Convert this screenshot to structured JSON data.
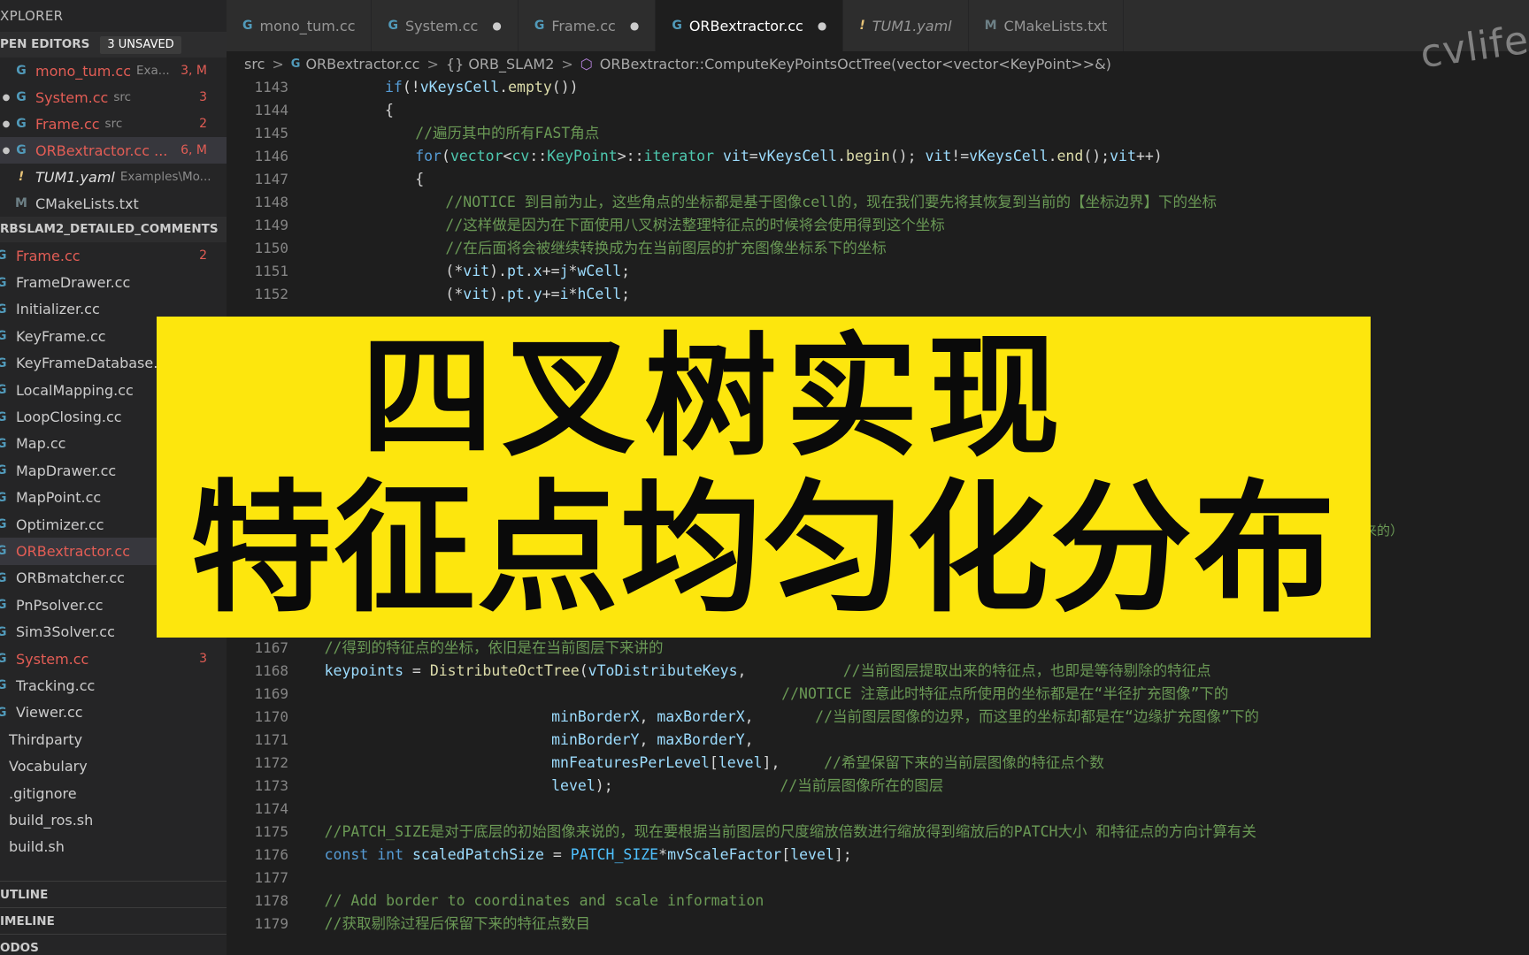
{
  "sidebar": {
    "title": "XPLORER",
    "open_editors": {
      "label": "PEN EDITORS",
      "badge": "3 UNSAVED",
      "items": [
        {
          "name": "mono_tum.cc",
          "desc": "Exa...",
          "status": "3, M",
          "dirty": false
        },
        {
          "name": "System.cc",
          "desc": "src",
          "status": "3",
          "dirty": true
        },
        {
          "name": "Frame.cc",
          "desc": "src",
          "status": "2",
          "dirty": true
        },
        {
          "name": "ORBextractor.cc ...",
          "desc": "",
          "status": "6, M",
          "dirty": true
        },
        {
          "name": "TUM1.yaml",
          "desc": "Examples\\Mo...",
          "status": "",
          "dirty": false
        },
        {
          "name": "CMakeLists.txt",
          "desc": "",
          "status": "",
          "dirty": false
        }
      ]
    },
    "project": {
      "label": "RBSLAM2_DETAILED_COMMENTS",
      "files": [
        {
          "name": "Frame.cc",
          "status": "2"
        },
        {
          "name": "FrameDrawer.cc",
          "status": ""
        },
        {
          "name": "Initializer.cc",
          "status": ""
        },
        {
          "name": "KeyFrame.cc",
          "status": ""
        },
        {
          "name": "KeyFrameDatabase.",
          "status": ""
        },
        {
          "name": "LocalMapping.cc",
          "status": ""
        },
        {
          "name": "LoopClosing.cc",
          "status": ""
        },
        {
          "name": "Map.cc",
          "status": ""
        },
        {
          "name": "MapDrawer.cc",
          "status": ""
        },
        {
          "name": "MapPoint.cc",
          "status": ""
        },
        {
          "name": "Optimizer.cc",
          "status": ""
        },
        {
          "name": "ORBextractor.cc",
          "status": ""
        },
        {
          "name": "ORBmatcher.cc",
          "status": ""
        },
        {
          "name": "PnPsolver.cc",
          "status": ""
        },
        {
          "name": "Sim3Solver.cc",
          "status": ""
        },
        {
          "name": "System.cc",
          "status": "3"
        },
        {
          "name": "Tracking.cc",
          "status": ""
        },
        {
          "name": "Viewer.cc",
          "status": ""
        },
        {
          "name": "Thirdparty",
          "status": ""
        },
        {
          "name": "Vocabulary",
          "status": ""
        },
        {
          "name": ".gitignore",
          "status": ""
        },
        {
          "name": "build_ros.sh",
          "status": ""
        },
        {
          "name": "build.sh",
          "status": ""
        }
      ]
    },
    "outline": "UTLINE",
    "timeline": "IMELINE",
    "todos": "ODOS"
  },
  "tabs": [
    {
      "label": "mono_tum.cc",
      "dirty": false,
      "active": false
    },
    {
      "label": "System.cc",
      "dirty": true,
      "active": false
    },
    {
      "label": "Frame.cc",
      "dirty": true,
      "active": false
    },
    {
      "label": "ORBextractor.cc",
      "dirty": true,
      "active": true
    },
    {
      "label": "TUM1.yaml",
      "dirty": false,
      "active": false
    },
    {
      "label": "CMakeLists.txt",
      "dirty": false,
      "active": false
    }
  ],
  "breadcrumb": {
    "src": "src",
    "file": "ORBextractor.cc",
    "namespace": "{} ORB_SLAM2",
    "symbol": "ORBextractor::ComputeKeyPointsOctTree(vector<vector<KeyPoint>>&)"
  },
  "watermark": "cvlife",
  "banner": {
    "line1": "四叉树实现",
    "line2": "特征点均匀化分布"
  },
  "editor": {
    "partial_right_text": "来的）",
    "lines": [
      {
        "n": "1143",
        "indent": 20,
        "segs": [
          [
            "kw",
            "if"
          ],
          [
            "pl",
            "(!"
          ],
          [
            "vr",
            "vKeysCell"
          ],
          [
            "pl",
            "."
          ],
          [
            "fn",
            "empty"
          ],
          [
            "pl",
            "())"
          ]
        ]
      },
      {
        "n": "1144",
        "indent": 20,
        "segs": [
          [
            "pl",
            "{"
          ]
        ]
      },
      {
        "n": "1145",
        "indent": 24,
        "segs": [
          [
            "cmt",
            "//遍历其中的所有FAST角点"
          ]
        ]
      },
      {
        "n": "1146",
        "indent": 24,
        "segs": [
          [
            "kw",
            "for"
          ],
          [
            "pl",
            "("
          ],
          [
            "ty",
            "vector"
          ],
          [
            "pl",
            "<"
          ],
          [
            "ty",
            "cv"
          ],
          [
            "pl",
            "::"
          ],
          [
            "ty",
            "KeyPoint"
          ],
          [
            "pl",
            ">::"
          ],
          [
            "ty",
            "iterator"
          ],
          [
            "pl",
            " "
          ],
          [
            "vr",
            "vit"
          ],
          [
            "pl",
            "="
          ],
          [
            "vr",
            "vKeysCell"
          ],
          [
            "pl",
            "."
          ],
          [
            "fn",
            "begin"
          ],
          [
            "pl",
            "(); "
          ],
          [
            "vr",
            "vit"
          ],
          [
            "pl",
            "!="
          ],
          [
            "vr",
            "vKeysCell"
          ],
          [
            "pl",
            "."
          ],
          [
            "fn",
            "end"
          ],
          [
            "pl",
            "();"
          ],
          [
            "vr",
            "vit"
          ],
          [
            "pl",
            "++)"
          ]
        ]
      },
      {
        "n": "1147",
        "indent": 24,
        "segs": [
          [
            "pl",
            "{"
          ]
        ]
      },
      {
        "n": "1148",
        "indent": 28,
        "segs": [
          [
            "cmt",
            "//NOTICE 到目前为止，这些角点的坐标都是基于图像cell的，现在我们要先将其恢复到当前的【坐标边界】下的坐标"
          ]
        ]
      },
      {
        "n": "1149",
        "indent": 28,
        "segs": [
          [
            "cmt",
            "//这样做是因为在下面使用八叉树法整理特征点的时候将会使用得到这个坐标"
          ]
        ]
      },
      {
        "n": "1150",
        "indent": 28,
        "segs": [
          [
            "cmt",
            "//在后面将会被继续转换成为在当前图层的扩充图像坐标系下的坐标"
          ]
        ]
      },
      {
        "n": "1151",
        "indent": 28,
        "segs": [
          [
            "pl",
            "(*"
          ],
          [
            "vr",
            "vit"
          ],
          [
            "pl",
            ")."
          ],
          [
            "vr",
            "pt"
          ],
          [
            "pl",
            "."
          ],
          [
            "vr",
            "x"
          ],
          [
            "pl",
            "+="
          ],
          [
            "vr",
            "j"
          ],
          [
            "pl",
            "*"
          ],
          [
            "vr",
            "wCell"
          ],
          [
            "pl",
            ";"
          ]
        ]
      },
      {
        "n": "1152",
        "indent": 28,
        "segs": [
          [
            "pl",
            "(*"
          ],
          [
            "vr",
            "vit"
          ],
          [
            "pl",
            ")."
          ],
          [
            "vr",
            "pt"
          ],
          [
            "pl",
            "."
          ],
          [
            "vr",
            "y"
          ],
          [
            "pl",
            "+="
          ],
          [
            "vr",
            "i"
          ],
          [
            "pl",
            "*"
          ],
          [
            "vr",
            "hCell"
          ],
          [
            "pl",
            ";"
          ]
        ]
      },
      {
        "n": "1167",
        "indent": 12,
        "segs": [
          [
            "cmt",
            "//得到的特征点的坐标，依旧是在当前图层下来讲的"
          ]
        ]
      },
      {
        "n": "1168",
        "indent": 12,
        "segs": [
          [
            "vr",
            "keypoints"
          ],
          [
            "pl",
            " = "
          ],
          [
            "fn",
            "DistributeOctTree"
          ],
          [
            "pl",
            "("
          ],
          [
            "vr",
            "vToDistributeKeys"
          ],
          [
            "pl",
            ",           "
          ],
          [
            "cmt",
            "//当前图层提取出来的特征点，也即是等待剔除的特征点"
          ]
        ]
      },
      {
        "n": "1169",
        "indent": 12,
        "segs": [
          [
            "pl",
            "                                                    "
          ],
          [
            "cmt",
            "//NOTICE 注意此时特征点所使用的坐标都是在“半径扩充图像”下的"
          ]
        ]
      },
      {
        "n": "1170",
        "indent": 42,
        "segs": [
          [
            "vr",
            "minBorderX"
          ],
          [
            "pl",
            ", "
          ],
          [
            "vr",
            "maxBorderX"
          ],
          [
            "pl",
            ",       "
          ],
          [
            "cmt",
            "//当前图层图像的边界，而这里的坐标却都是在“边缘扩充图像”下的"
          ]
        ]
      },
      {
        "n": "1171",
        "indent": 42,
        "segs": [
          [
            "vr",
            "minBorderY"
          ],
          [
            "pl",
            ", "
          ],
          [
            "vr",
            "maxBorderY"
          ],
          [
            "pl",
            ","
          ]
        ]
      },
      {
        "n": "1172",
        "indent": 42,
        "segs": [
          [
            "vr",
            "mnFeaturesPerLevel"
          ],
          [
            "pl",
            "["
          ],
          [
            "vr",
            "level"
          ],
          [
            "pl",
            "],     "
          ],
          [
            "cmt",
            "//希望保留下来的当前层图像的特征点个数"
          ]
        ]
      },
      {
        "n": "1173",
        "indent": 42,
        "segs": [
          [
            "vr",
            "level"
          ],
          [
            "pl",
            ");                   "
          ],
          [
            "cmt",
            "//当前层图像所在的图层"
          ]
        ]
      },
      {
        "n": "1174",
        "indent": 12,
        "segs": []
      },
      {
        "n": "1175",
        "indent": 12,
        "segs": [
          [
            "cmt",
            "//PATCH_SIZE是对于底层的初始图像来说的，现在要根据当前图层的尺度缩放倍数进行缩放得到缩放后的PATCH大小 和特征点的方向计算有关"
          ]
        ]
      },
      {
        "n": "1176",
        "indent": 12,
        "segs": [
          [
            "kw",
            "const"
          ],
          [
            "pl",
            " "
          ],
          [
            "kw",
            "int"
          ],
          [
            "pl",
            " "
          ],
          [
            "vr",
            "scaledPatchSize"
          ],
          [
            "pl",
            " = "
          ],
          [
            "cn",
            "PATCH_SIZE"
          ],
          [
            "pl",
            "*"
          ],
          [
            "vr",
            "mvScaleFactor"
          ],
          [
            "pl",
            "["
          ],
          [
            "vr",
            "level"
          ],
          [
            "pl",
            "];"
          ]
        ]
      },
      {
        "n": "1177",
        "indent": 12,
        "segs": []
      },
      {
        "n": "1178",
        "indent": 12,
        "segs": [
          [
            "cmt",
            "// Add border to coordinates and scale information"
          ]
        ]
      },
      {
        "n": "1179",
        "indent": 12,
        "segs": [
          [
            "cmt",
            "//获取剔除过程后保留下来的特征点数目"
          ]
        ]
      }
    ]
  }
}
